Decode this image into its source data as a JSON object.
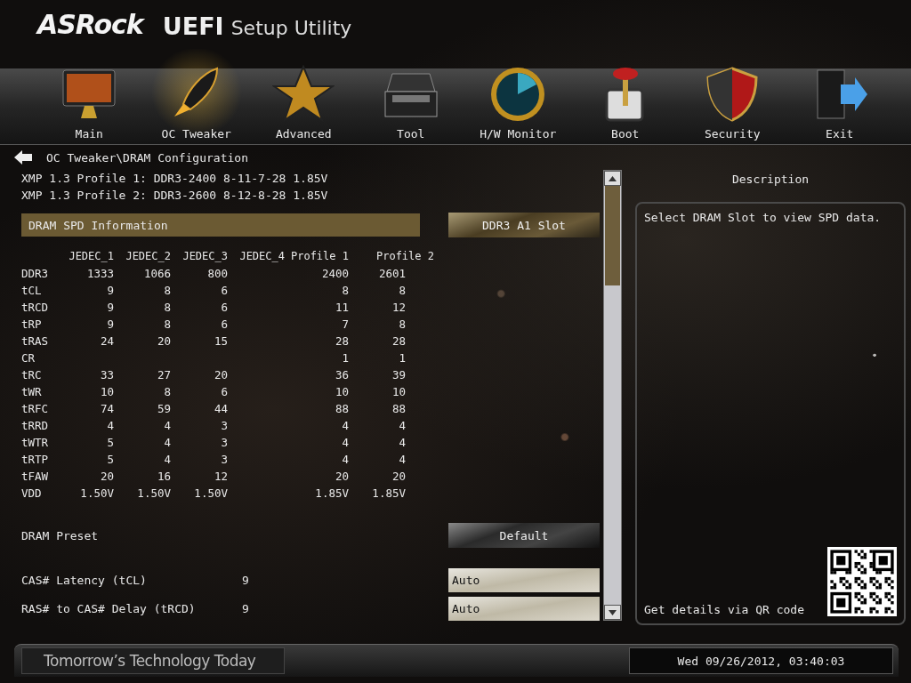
{
  "header": {
    "brand": "ASRock",
    "title": "UEFI",
    "subtitle": "Setup Utility"
  },
  "nav": [
    {
      "label": "Main",
      "selected": false
    },
    {
      "label": "OC Tweaker",
      "selected": true
    },
    {
      "label": "Advanced",
      "selected": false
    },
    {
      "label": "Tool",
      "selected": false
    },
    {
      "label": "H/W Monitor",
      "selected": false
    },
    {
      "label": "Boot",
      "selected": false
    },
    {
      "label": "Security",
      "selected": false
    },
    {
      "label": "Exit",
      "selected": false
    }
  ],
  "breadcrumb": "OC Tweaker\\DRAM Configuration",
  "xmp_profiles": [
    "XMP 1.3 Profile 1: DDR3-2400 8-11-7-28 1.85V",
    "XMP 1.3 Profile 2: DDR3-2600 8-12-8-28 1.85V"
  ],
  "spd_section": {
    "label": "DRAM SPD Information",
    "selected": true,
    "slot_button": "DDR3 A1 Slot"
  },
  "spd_table": {
    "columns": [
      "JEDEC_1",
      "JEDEC_2",
      "JEDEC_3",
      "JEDEC_4",
      "Profile 1",
      "Profile 2"
    ],
    "rows": [
      {
        "label": "DDR3",
        "jedec_1": "1333",
        "jedec_2": "1066",
        "jedec_3": "800",
        "profile_1": "2400",
        "profile_2": "2601"
      },
      {
        "label": "tCL",
        "jedec_1": "9",
        "jedec_2": "8",
        "jedec_3": "6",
        "profile_1": "8",
        "profile_2": "8"
      },
      {
        "label": "tRCD",
        "jedec_1": "9",
        "jedec_2": "8",
        "jedec_3": "6",
        "profile_1": "11",
        "profile_2": "12"
      },
      {
        "label": "tRP",
        "jedec_1": "9",
        "jedec_2": "8",
        "jedec_3": "6",
        "profile_1": "7",
        "profile_2": "8"
      },
      {
        "label": "tRAS",
        "jedec_1": "24",
        "jedec_2": "20",
        "jedec_3": "15",
        "profile_1": "28",
        "profile_2": "28"
      },
      {
        "label": "CR",
        "profile_1": "1",
        "profile_2": "1"
      },
      {
        "label": "tRC",
        "jedec_1": "33",
        "jedec_2": "27",
        "jedec_3": "20",
        "profile_1": "36",
        "profile_2": "39"
      },
      {
        "label": "tWR",
        "jedec_1": "10",
        "jedec_2": "8",
        "jedec_3": "6",
        "profile_1": "10",
        "profile_2": "10"
      },
      {
        "label": "tRFC",
        "jedec_1": "74",
        "jedec_2": "59",
        "jedec_3": "44",
        "profile_1": "88",
        "profile_2": "88"
      },
      {
        "label": "tRRD",
        "jedec_1": "4",
        "jedec_2": "4",
        "jedec_3": "3",
        "profile_1": "4",
        "profile_2": "4"
      },
      {
        "label": "tWTR",
        "jedec_1": "5",
        "jedec_2": "4",
        "jedec_3": "3",
        "profile_1": "4",
        "profile_2": "4"
      },
      {
        "label": "tRTP",
        "jedec_1": "5",
        "jedec_2": "4",
        "jedec_3": "3",
        "profile_1": "4",
        "profile_2": "4"
      },
      {
        "label": "tFAW",
        "jedec_1": "20",
        "jedec_2": "16",
        "jedec_3": "12",
        "profile_1": "20",
        "profile_2": "20"
      },
      {
        "label": "VDD",
        "jedec_1": "1.50V",
        "jedec_2": "1.50V",
        "jedec_3": "1.50V",
        "profile_1": "1.85V",
        "profile_2": "1.85V"
      }
    ]
  },
  "settings": [
    {
      "kind": "button",
      "label": "DRAM Preset",
      "control": "Default"
    },
    {
      "kind": "field",
      "label": "CAS# Latency (tCL)",
      "current": "9",
      "control": "Auto"
    },
    {
      "kind": "field",
      "label": "RAS# to CAS# Delay (tRCD)",
      "current": "9",
      "control": "Auto"
    }
  ],
  "description": {
    "title": "Description",
    "text": "Select DRAM Slot to view SPD data.",
    "qr_caption": "Get details via QR code"
  },
  "footer": {
    "slogan": "Tomorrow’s Technology Today",
    "datetime": "Wed 09/26/2012, 03:40:03"
  }
}
